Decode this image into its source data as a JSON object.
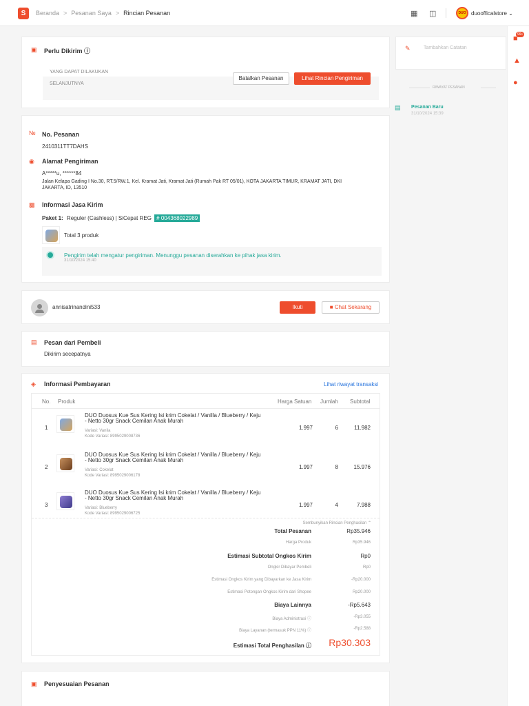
{
  "header": {
    "breadcrumb": [
      "Beranda",
      "Pesanan Saya",
      "Rincian Pesanan"
    ],
    "store_name": "duoofficalstore",
    "avatar_text": "DUO"
  },
  "sidebar": {
    "badge": "99+"
  },
  "status_card": {
    "title": "Perlu Dikirim",
    "next_action_label_line1": "YANG DAPAT DILAKUKAN",
    "next_action_label_line2": "SELANJUTNYA",
    "cancel_button": "Batalkan Pesanan",
    "shipping_button": "Lihat Rincian Pengiriman"
  },
  "order": {
    "number_label": "No. Pesanan",
    "number": "2410311TT7DAHS",
    "address_label": "Alamat Pengiriman",
    "recipient": "A*****u, ******84",
    "address_line1": "Jalan Kelapa Gading I No.30, RT.5/RW.1, Kel. Kramat Jati, Kramat Jati (Rumah Pak RT 05/01), KOTA JAKARTA TIMUR, KRAMAT JATI, DKI",
    "address_line2": "JAKARTA, ID, 13510",
    "courier_label": "Informasi Jasa Kirim",
    "package_label": "Paket 1:",
    "package_info": "Reguler (Cashless)  |  SiCepat REG",
    "tracking": "# 004368022989",
    "total_products": "Total 3 produk",
    "status_message": "Pengirim telah mengatur pengiriman. Menunggu pesanan diserahkan ke pihak jasa kirim.",
    "status_time": "31/10/2024 15:40"
  },
  "buyer": {
    "username": "annisatrinandini533",
    "follow_button": "Ikuti",
    "chat_button": "Chat Sekarang"
  },
  "buyer_message": {
    "title": "Pesan dari Pembeli",
    "text": "Dikirim secepatnya"
  },
  "payment": {
    "title": "Informasi Pembayaran",
    "history_link": "Lihat riwayat transaksi",
    "columns": {
      "no": "No.",
      "product": "Produk",
      "price": "Harga Satuan",
      "qty": "Jumlah",
      "subtotal": "Subtotal"
    },
    "rows": [
      {
        "no": "1",
        "name_line1": "DUO Duosus Kue Sus Kering Isi krim Cokelat / Vanilla / Blueberry / Keju",
        "name_line2": "- Netto 30gr Snack Cemilan Anak Murah",
        "variant": "Variasi: Vanila",
        "code": "Kode Variasi: 8995029008736",
        "price": "1.997",
        "qty": "6",
        "subtotal": "11.982"
      },
      {
        "no": "2",
        "name_line1": "DUO Duosus Kue Sus Kering Isi krim Cokelat / Vanilla / Blueberry / Keju",
        "name_line2": "- Netto 30gr Snack Cemilan Anak Murah",
        "variant": "Variasi: Cokelat",
        "code": "Kode Variasi: 8995029006178",
        "price": "1.997",
        "qty": "8",
        "subtotal": "15.976"
      },
      {
        "no": "3",
        "name_line1": "DUO Duosus Kue Sus Kering Isi krim Cokelat / Vanilla / Blueberry / Keju",
        "name_line2": "- Netto 30gr Snack Cemilan Anak Murah",
        "variant": "Variasi: Blueberry",
        "code": "Kode Variasi: 8995029006725",
        "price": "1.997",
        "qty": "4",
        "subtotal": "7.988"
      }
    ],
    "hide_details": "Sembunyikan Rincian Penghasilan",
    "summary": [
      {
        "label": "Total Pesanan",
        "value": "Rp35.946",
        "bold": true
      },
      {
        "label": "Harga Produk",
        "value": "Rp35.946",
        "bold": false
      },
      {
        "label": "Estimasi Subtotal Ongkos Kirim",
        "value": "Rp0",
        "bold": true
      },
      {
        "label": "Ongkir Dibayar Pembeli",
        "value": "Rp0",
        "bold": false
      },
      {
        "label": "Estimasi Ongkos Kirim yang Dibayarkan ke Jasa Kirim",
        "value": "-Rp20.000",
        "bold": false
      },
      {
        "label": "Estimasi Potongan Ongkos Kirim dari Shopee",
        "value": "Rp20.000",
        "bold": false
      },
      {
        "label": "Biaya Lainnya",
        "value": "-Rp5.643",
        "bold": true
      },
      {
        "label": "Biaya Administrasi ⓘ",
        "value": "-Rp3.055",
        "bold": false
      },
      {
        "label": "Biaya Layanan (termasuk PPN 11%) ⓘ",
        "value": "-Rp2.588",
        "bold": false
      }
    ],
    "total_label": "Estimasi Total Penghasilan ⓘ",
    "total_value": "Rp30.303"
  },
  "adjustment": {
    "title": "Penyesuaian Pesanan"
  },
  "right_panel": {
    "note_placeholder": "Tambahkan Catatan",
    "history_title": "RIWAYAT PESANAN",
    "history_item": "Pesanan Baru",
    "history_time": "31/10/2024 15:39"
  },
  "colors": {
    "accent": "#ee4d2d",
    "teal": "#26aa99",
    "link": "#2673dd"
  }
}
